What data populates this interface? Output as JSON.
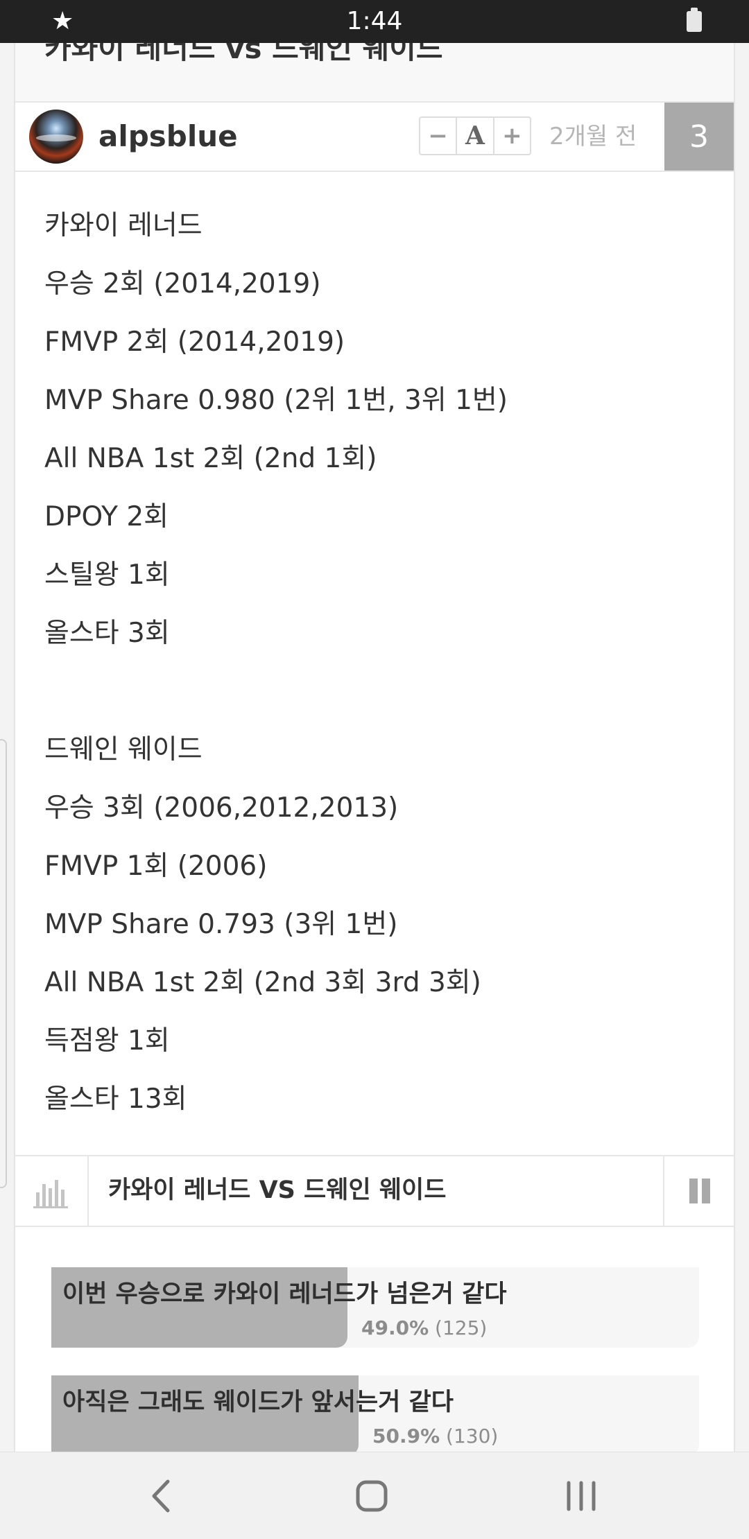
{
  "status_bar": {
    "time": "1:44",
    "left_icon": "star-icon",
    "right_icon": "battery-icon"
  },
  "article": {
    "title": "카와이 레너드 vs 드웨인 웨이드",
    "author": "alpsblue",
    "time_ago": "2개월 전",
    "comment_count": "3",
    "font_controls": {
      "decrease": "−",
      "reset": "A",
      "increase": "+"
    },
    "body": {
      "kawhi": [
        "카와이 레너드",
        "우승 2회 (2014,2019)",
        "FMVP 2회 (2014,2019)",
        "MVP Share 0.980 (2위 1번, 3위 1번)",
        "All NBA 1st 2회 (2nd 1회)",
        "DPOY 2회",
        "스틸왕 1회",
        "올스타 3회"
      ],
      "wade": [
        "드웨인 웨이드",
        "우승 3회 (2006,2012,2013)",
        "FMVP 1회 (2006)",
        "MVP Share 0.793 (3위 1번)",
        "All NBA 1st 2회 (2nd 3회 3rd 3회)",
        "득점왕 1회",
        "올스타 13회"
      ]
    }
  },
  "poll": {
    "title": "카와이 레너드 VS 드웨인 웨이드",
    "chart_icon": "bar-chart-icon",
    "pause_icon": "pause-icon",
    "options": [
      {
        "label": "이번 우승으로 카와이 레너드가 넘은거 같다",
        "percent_text": "49.0%",
        "count_text": "(125)",
        "fraction": 0.49
      },
      {
        "label": "아직은 그래도 웨이드가 앞서는거 같다",
        "percent_text": "50.9%",
        "count_text": "(130)",
        "fraction": 0.509
      }
    ]
  },
  "nav_bar": {
    "buttons": [
      "back-icon",
      "home-icon",
      "recent-apps-icon"
    ]
  },
  "colors": {
    "status_bar": "#222222",
    "comment_badge": "#a9a9a9",
    "poll_fill": "#b1b1b1",
    "text": "#333333"
  }
}
